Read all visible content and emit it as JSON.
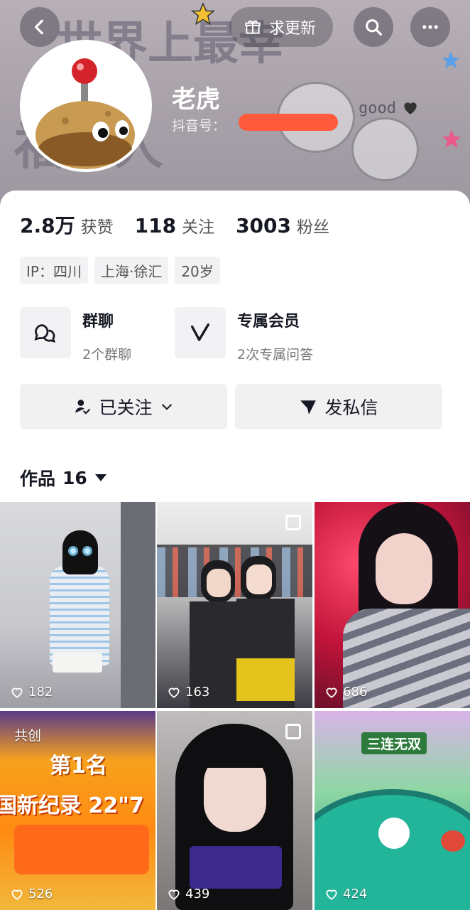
{
  "header": {
    "refresh_label": "求更新",
    "banner_text": [
      "世界上最幸",
      "福的人"
    ],
    "banner_sticker_text": "good"
  },
  "profile": {
    "name": "老虎",
    "douyin_id_label": "抖音号："
  },
  "stats": [
    {
      "value": "2.8万",
      "label": "获赞"
    },
    {
      "value": "118",
      "label": "关注"
    },
    {
      "value": "3003",
      "label": "粉丝"
    }
  ],
  "tags": [
    "IP：四川",
    "上海·徐汇",
    "20岁"
  ],
  "features": [
    {
      "title": "群聊",
      "subtitle": "2个群聊"
    },
    {
      "title": "专属会员",
      "subtitle": "2次专属问答"
    }
  ],
  "actions": {
    "follow_label": "已关注",
    "message_label": "发私信"
  },
  "works": {
    "label": "作品",
    "count": "16"
  },
  "grid": [
    {
      "likes": "182",
      "multi": false
    },
    {
      "likes": "163",
      "multi": true
    },
    {
      "likes": "686",
      "multi": false
    },
    {
      "likes": "526",
      "multi": false,
      "badge": "共创",
      "overlay_text": [
        "第1名",
        "国新纪录 22\"7"
      ]
    },
    {
      "likes": "439",
      "multi": true
    },
    {
      "likes": "424",
      "multi": false,
      "overlay_text": [
        "三连无双"
      ]
    }
  ],
  "colors": {
    "accent_red": "#ff5a3c",
    "card_bg": "#ffffff",
    "button_bg": "#f1f1f2",
    "text_primary": "#161823"
  }
}
